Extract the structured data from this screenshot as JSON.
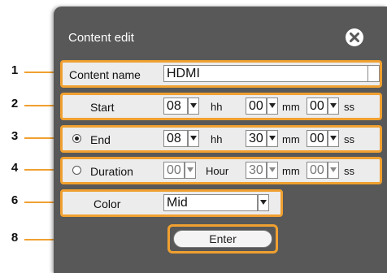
{
  "dialog": {
    "title": "Content edit",
    "close_icon": "close-icon"
  },
  "callouts": [
    "1",
    "2",
    "3",
    "4",
    "6",
    "8"
  ],
  "content_name": {
    "label": "Content name",
    "value": "HDMI"
  },
  "start": {
    "label": "Start",
    "hh": "08",
    "hh_unit": "hh",
    "mm": "00",
    "mm_unit": "mm",
    "ss": "00",
    "ss_unit": "ss"
  },
  "end": {
    "label": "End",
    "selected": true,
    "hh": "08",
    "hh_unit": "hh",
    "mm": "30",
    "mm_unit": "mm",
    "ss": "00",
    "ss_unit": "ss"
  },
  "duration": {
    "label": "Duration",
    "selected": false,
    "hour": "00",
    "hour_unit": "Hour",
    "mm": "30",
    "mm_unit": "mm",
    "ss": "00",
    "ss_unit": "ss"
  },
  "color": {
    "label": "Color",
    "value": "Mid"
  },
  "enter_label": "Enter",
  "colors": {
    "accent": "#f0a030",
    "dialog_bg": "#585858",
    "row_bg": "#ececec"
  }
}
